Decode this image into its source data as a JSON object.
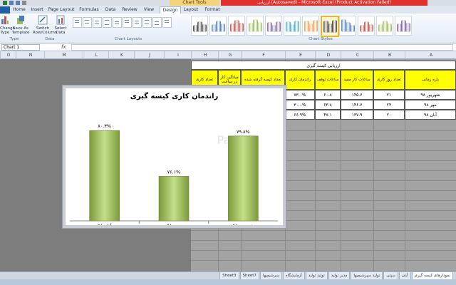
{
  "window": {
    "title": "ارزیابی (Autosaved) - Microsoft Excel (Product Activation Failed)",
    "chart_tools_label": "Chart Tools"
  },
  "tabs": [
    "Home",
    "Insert",
    "Page Layout",
    "Formulas",
    "Data",
    "Review",
    "View",
    "Design",
    "Layout",
    "Format"
  ],
  "active_tab": "Design",
  "ribbon": {
    "buttons": {
      "change_type": "Change Type",
      "save_template": "Save As Template",
      "switch": "Switch Row/Column",
      "select_data": "Select Data"
    },
    "groups": {
      "type": "Type",
      "data": "Data",
      "layouts": "Chart Layouts",
      "styles": "Chart Styles"
    },
    "style_colors": [
      "#404040",
      "#4f7cc1",
      "#c0504d",
      "#9bbb59",
      "#8064a2",
      "#4bacc6",
      "#f79646"
    ]
  },
  "formula_bar": {
    "name_box": "Chart 1",
    "fx": "fx"
  },
  "columns": [
    "O",
    "N",
    "M",
    "L",
    "K",
    "J",
    "I",
    "H",
    "G",
    "F",
    "E",
    "D",
    "C",
    "B",
    "A"
  ],
  "table": {
    "title": "ارزیابی کیسه گیری",
    "headers": [
      "بازه زمانی",
      "تعداد روز کاری",
      "ساعات کار مفید",
      "ساعات توقف",
      "راندمان کاری",
      "تعداد کیسه گرفته شده",
      "میانگین کار در ساعت",
      "تعداد کاری"
    ],
    "rows": [
      [
        "شهریور ۹۸",
        "۲۱",
        "۱۴۵.۷",
        "۶۰.۸",
        "۷۳.۰%"
      ],
      [
        "مهر ۹۸",
        "۲۳",
        "۱۴۶.۷",
        "۶۳.۸",
        "۳۰.۰%"
      ],
      [
        "آبان ۹۸",
        "۲۰",
        "۱۳۷.۹",
        "۴۷.۱",
        "۶۶.۹%"
      ]
    ]
  },
  "chart_data": {
    "type": "bar",
    "title": "راندمان کاری کیسه گیری",
    "categories": [
      "شهریور ۹۸",
      "مهر ۹۸",
      "آبان ۹۸"
    ],
    "values": [
      79.8,
      76.1,
      80.3
    ],
    "data_labels": [
      "۷۹.۸%",
      "۷۶.۱%",
      "۸۰.۳%"
    ],
    "ylim": [
      72,
      83
    ],
    "bar_color": "#9bbb59",
    "grid": false,
    "legend": "none"
  },
  "watermark": "Page",
  "sheet_tabs": [
    "نمودارهای کیسه گیری",
    "آبان",
    "سپتی",
    "تولید سپرشیمیها",
    "مدیر تولید",
    "تولید تولید",
    "آزمایشگاه",
    "سرشیمیها",
    "Sheet7",
    "Sheet3"
  ],
  "active_sheet": "نمودارهای کیسه گیری"
}
